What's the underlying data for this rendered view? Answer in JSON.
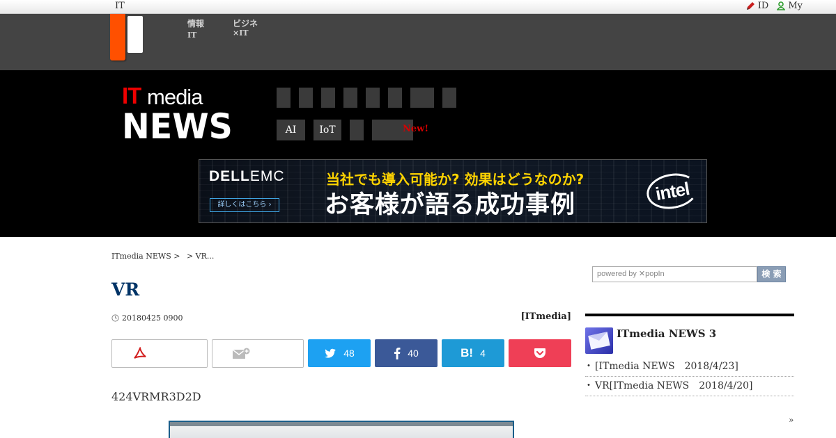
{
  "topbar": {
    "brand": "IT",
    "links": [
      {
        "label": "ID",
        "icon": "pencil-icon"
      },
      {
        "label": "My",
        "icon": "user-icon"
      }
    ]
  },
  "network_nav": [
    {
      "line1": "情報",
      "line2": "IT"
    },
    {
      "line1": "ビジネ",
      "line2": "×IT"
    }
  ],
  "site": {
    "logo_it": "IT",
    "logo_media": "media",
    "logo_news": "NEWS"
  },
  "category_tags": [
    {
      "label": "AI"
    },
    {
      "label": "IoT"
    },
    {
      "label": ""
    },
    {
      "label": ""
    }
  ],
  "new_label": "New!",
  "banner": {
    "brand": "DELL",
    "brand_suffix": "EMC",
    "cta": "詳しくはこちら ›",
    "line1": "当社でも導入可能か? 効果はどうなのか?",
    "line2": "お客様が語る成功事例",
    "partner": "intel"
  },
  "breadcrumb": [
    "ITmedia NEWS >",
    "> VR..."
  ],
  "article": {
    "title": "VR",
    "date": "20180425 0900",
    "source": "[ITmedia]",
    "lead": "424VRMR3D2D"
  },
  "share": {
    "twitter_count": "48",
    "facebook_count": "40",
    "hatena_glyph": "B!",
    "hatena_count": "4"
  },
  "sidebar": {
    "search_placeholder": "powered by ✕popIn",
    "search_button": "検 索",
    "newsletter_title": "ITmedia NEWS 3",
    "items": [
      {
        "text": "[ITmedia NEWS　2018/4/23]"
      },
      {
        "text": "VR[ITmedia NEWS　2018/4/20]"
      }
    ],
    "more": "»"
  },
  "colors": {
    "accent_orange": "#ff5000",
    "header_black": "#000000",
    "title_blue": "#003366",
    "twitter": "#1da1f2",
    "facebook": "#3b5998",
    "hatena": "#1e9ad6",
    "pocket": "#ef3f56"
  }
}
